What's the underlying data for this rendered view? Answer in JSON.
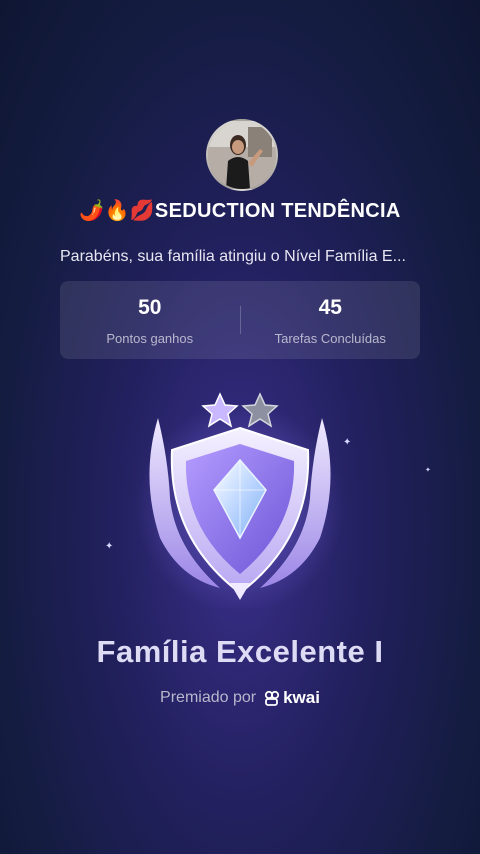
{
  "profile": {
    "name": "🌶️🔥💋SEDUCTION TENDÊNCIA"
  },
  "message": "Parabéns, sua família atingiu o Nível Família E...",
  "stats": [
    {
      "value": "50",
      "label": "Pontos ganhos"
    },
    {
      "value": "45",
      "label": "Tarefas Concluídas"
    }
  ],
  "badge": {
    "stars_total": 2,
    "stars_filled": 1,
    "icon": "shield-crystal-badge"
  },
  "level": {
    "title": "Família Excelente I"
  },
  "awarded": {
    "prefix": "Premiado por",
    "brand": "kwai"
  },
  "colors": {
    "background_top": "#141c40",
    "background_center": "#3a2f8a",
    "shield_purple": "#8f7bf0",
    "crystal": "#cfe2ff"
  }
}
